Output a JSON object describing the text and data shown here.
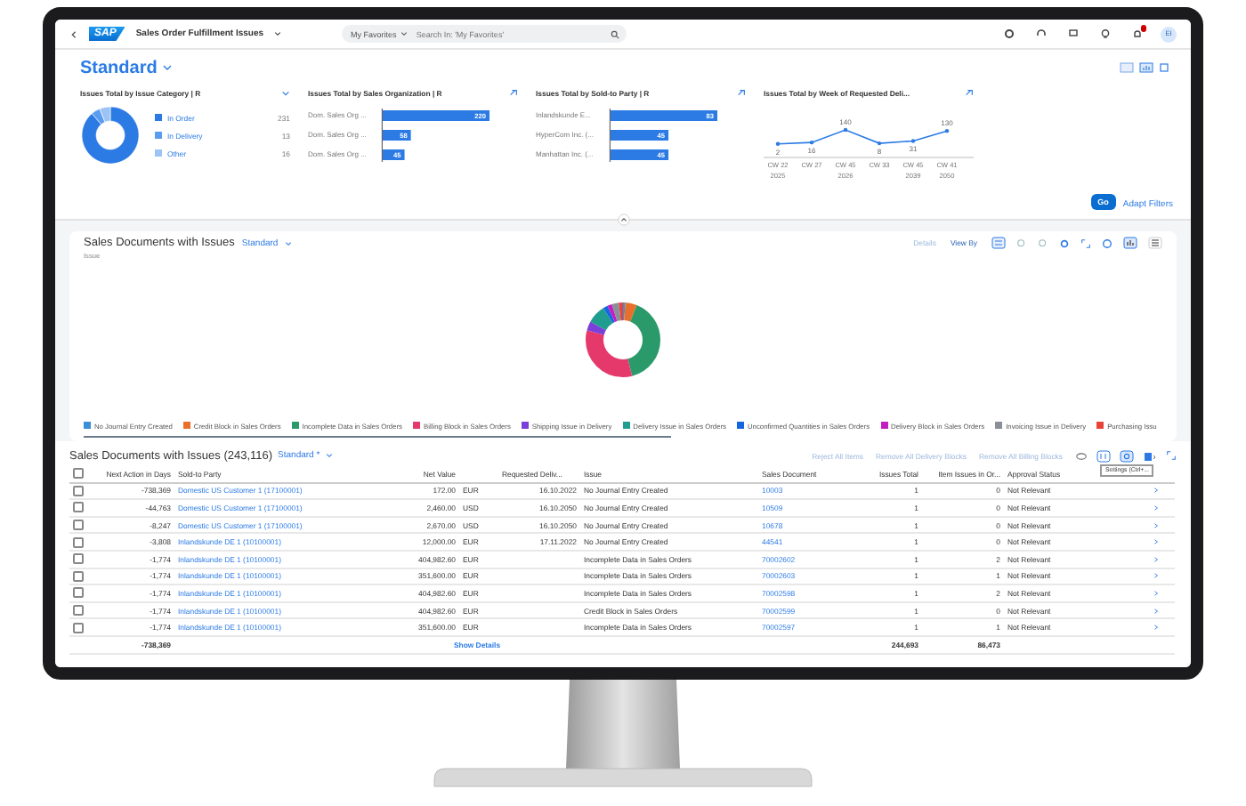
{
  "shell": {
    "logo": "SAP",
    "title": "Sales Order Fulfillment Issues",
    "favorites": "My Favorites",
    "search_placeholder": "Search In: 'My Favorites'",
    "avatar": "EI",
    "notifications": true
  },
  "header": {
    "variant": "Standard",
    "go": "Go",
    "adapt_filters": "Adapt Filters"
  },
  "cards": [
    {
      "title": "Issues Total by Issue Category | R",
      "chart_data": {
        "type": "donut",
        "categories": [
          "In Order",
          "In Delivery",
          "Other"
        ],
        "values": [
          231,
          13,
          16
        ],
        "value_labels": [
          "231",
          "13",
          "16"
        ],
        "legend": "right",
        "colors": [
          "#2c7be5",
          "#5a9cf0",
          "#9cc3f5"
        ]
      }
    },
    {
      "title": "Issues Total by Sales Organization | R",
      "chart_data": {
        "type": "bar",
        "orientation": "horizontal",
        "categories": [
          "Dom. Sales Org ...",
          "Dom. Sales Org ...",
          "Dom. Sales Org ..."
        ],
        "values": [
          220,
          58,
          45
        ],
        "data_labels": true
      }
    },
    {
      "title": "Issues Total by Sold-to Party | R",
      "chart_data": {
        "type": "bar",
        "orientation": "horizontal",
        "categories": [
          "Inlandskunde E...",
          "HyperCom Inc. (...",
          "Manhattan Inc. (..."
        ],
        "values": [
          83,
          45,
          45
        ],
        "data_labels": true
      }
    },
    {
      "title": "Issues Total by Week of Requested Deli...",
      "chart_data": {
        "type": "line",
        "categories": [
          "CW 22 2025",
          "CW 27",
          "CW 45 2026",
          "CW 33",
          "CW 45 2039",
          "CW 41 2050"
        ],
        "values": [
          2,
          16,
          140,
          8,
          31,
          130
        ],
        "data_labels": true
      }
    }
  ],
  "chart_section": {
    "title": "Sales Documents with Issues",
    "variant": "Standard",
    "details": {
      "label": "Details",
      "disabled": true
    },
    "view_by": "View By",
    "axis_label": "Issue",
    "view_mode": [
      {
        "kind": "chart",
        "selected": true
      },
      {
        "kind": "table",
        "selected": false
      }
    ],
    "legend": [
      {
        "label": "No Journal Entry Created",
        "color": "#3b8fd9"
      },
      {
        "label": "Credit Block in Sales Orders",
        "color": "#e8702a"
      },
      {
        "label": "Incomplete Data in Sales Orders",
        "color": "#2b9a6b"
      },
      {
        "label": "Billing Block in Sales Orders",
        "color": "#e5386b"
      },
      {
        "label": "Shipping Issue in Delivery",
        "color": "#7d3fd9"
      },
      {
        "label": "Delivery Issue in Sales Orders",
        "color": "#1f9e8f"
      },
      {
        "label": "Unconfirmed Quantities in Sales Orders",
        "color": "#1466e0"
      },
      {
        "label": "Delivery Block in Sales Orders",
        "color": "#c21ec2"
      },
      {
        "label": "Invoicing Issue in Delivery",
        "color": "#8a8f9a"
      },
      {
        "label": "Purchasing Issu",
        "color": "#e8433a"
      }
    ]
  },
  "table": {
    "title": "Sales Documents with Issues (243,116)",
    "variant": "Standard *",
    "actions": [
      {
        "label": "Reject All Items",
        "disabled": true
      },
      {
        "label": "Remove All Delivery Blocks",
        "disabled": true
      },
      {
        "label": "Remove All Billing Blocks",
        "disabled": true
      }
    ],
    "tooltip": "Settings (Ctrl+...",
    "select_all": {
      "checked": false
    },
    "columns": [
      "Next Action in Days",
      "Sold-to Party",
      "Net Value",
      "Requested Deliv...",
      "Issue",
      "Sales Document",
      "Issues Total",
      "Item Issues in Or...",
      "Approval Status"
    ],
    "rows": [
      {
        "checked": false,
        "next_action": "-738,369",
        "sold_to": "Domestic US Customer 1 (17100001)",
        "net_value": "172.00",
        "currency": "EUR",
        "requested_delivery": "16.10.2022",
        "issue": "No Journal Entry Created",
        "sales_document": "10003",
        "issues_total": "1",
        "item_issues": "0",
        "approval_status": "Not Relevant"
      },
      {
        "checked": false,
        "next_action": "-44,763",
        "sold_to": "Domestic US Customer 1 (17100001)",
        "net_value": "2,460.00",
        "currency": "USD",
        "requested_delivery": "16.10.2050",
        "issue": "No Journal Entry Created",
        "sales_document": "10509",
        "issues_total": "1",
        "item_issues": "0",
        "approval_status": "Not Relevant"
      },
      {
        "checked": false,
        "next_action": "-8,247",
        "sold_to": "Domestic US Customer 1 (17100001)",
        "net_value": "2,670.00",
        "currency": "USD",
        "requested_delivery": "16.10.2050",
        "issue": "No Journal Entry Created",
        "sales_document": "10678",
        "issues_total": "1",
        "item_issues": "0",
        "approval_status": "Not Relevant"
      },
      {
        "checked": false,
        "next_action": "-3,808",
        "sold_to": "Inlandskunde DE 1 (10100001)",
        "net_value": "12,000.00",
        "currency": "EUR",
        "requested_delivery": "17.11.2022",
        "issue": "No Journal Entry Created",
        "sales_document": "44541",
        "issues_total": "1",
        "item_issues": "0",
        "approval_status": "Not Relevant"
      },
      {
        "checked": false,
        "next_action": "-1,774",
        "sold_to": "Inlandskunde DE 1 (10100001)",
        "net_value": "404,982.60",
        "currency": "EUR",
        "issue": "Incomplete Data in Sales Orders",
        "sales_document": "70002602",
        "issues_total": "1",
        "item_issues": "2",
        "approval_status": "Not Relevant"
      },
      {
        "checked": false,
        "next_action": "-1,774",
        "sold_to": "Inlandskunde DE 1 (10100001)",
        "net_value": "351,600.00",
        "currency": "EUR",
        "issue": "Incomplete Data in Sales Orders",
        "sales_document": "70002603",
        "issues_total": "1",
        "item_issues": "1",
        "approval_status": "Not Relevant"
      },
      {
        "checked": false,
        "next_action": "-1,774",
        "sold_to": "Inlandskunde DE 1 (10100001)",
        "net_value": "404,982.60",
        "currency": "EUR",
        "issue": "Incomplete Data in Sales Orders",
        "sales_document": "70002598",
        "issues_total": "1",
        "item_issues": "2",
        "approval_status": "Not Relevant"
      },
      {
        "checked": false,
        "next_action": "-1,774",
        "sold_to": "Inlandskunde DE 1 (10100001)",
        "net_value": "404,982.60",
        "currency": "EUR",
        "issue": "Credit Block in Sales Orders",
        "sales_document": "70002599",
        "issues_total": "1",
        "item_issues": "0",
        "approval_status": "Not Relevant"
      },
      {
        "checked": false,
        "next_action": "-1,774",
        "sold_to": "Inlandskunde DE 1 (10100001)",
        "net_value": "351,600.00",
        "currency": "EUR",
        "issue": "Incomplete Data in Sales Orders",
        "sales_document": "70002597",
        "issues_total": "1",
        "item_issues": "1",
        "approval_status": "Not Relevant"
      }
    ],
    "footer": {
      "next_action_total": "-738,369",
      "show_details": "Show Details",
      "issues_total": "244,693",
      "item_issues_total": "86,473"
    }
  }
}
